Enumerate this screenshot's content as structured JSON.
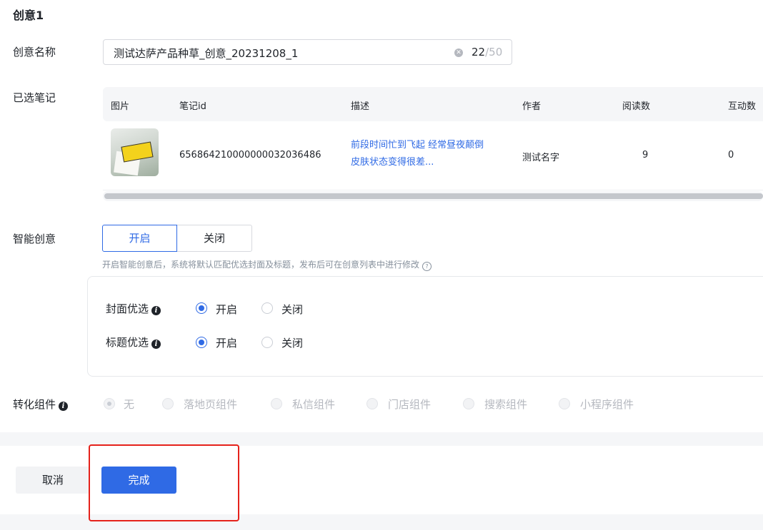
{
  "section_title": "创意1",
  "fields": {
    "name_label": "创意名称",
    "name_value": "测试达萨产品种草_创意_20231208_1",
    "name_count": "22",
    "name_max": "/50",
    "notes_label": "已选笔记",
    "smart_label": "智能创意",
    "convert_label": "转化组件"
  },
  "table": {
    "columns": [
      "图片",
      "笔记id",
      "描述",
      "作者",
      "阅读数",
      "互动数"
    ],
    "rows": [
      {
        "note_id": "656864210000000032036486",
        "desc_line1": "前段时间忙到飞起 经常昼夜颠倒",
        "desc_line2": "皮肤状态变得很差...",
        "author": "测试名字",
        "reads": "9",
        "interactions": "0"
      }
    ]
  },
  "smart": {
    "on_label": "开启",
    "off_label": "关闭",
    "selected": "开启",
    "hint": "开启智能创意后，系统将默认匹配优选封面及标题，发布后可在创意列表中进行修改",
    "cover": {
      "label": "封面优选",
      "on": "开启",
      "off": "关闭",
      "selected": "开启"
    },
    "headline": {
      "label": "标题优选",
      "on": "开启",
      "off": "关闭",
      "selected": "开启"
    }
  },
  "convert_options": [
    "无",
    "落地页组件",
    "私信组件",
    "门店组件",
    "搜索组件",
    "小程序组件"
  ],
  "convert_selected": "无",
  "footer": {
    "cancel": "取消",
    "done": "完成"
  },
  "colors": {
    "accent": "#2f6ae5",
    "highlight": "#e5221b"
  },
  "icons": {
    "clear": "clear-circle-icon",
    "info": "info-icon",
    "help": "question-circle-icon"
  }
}
